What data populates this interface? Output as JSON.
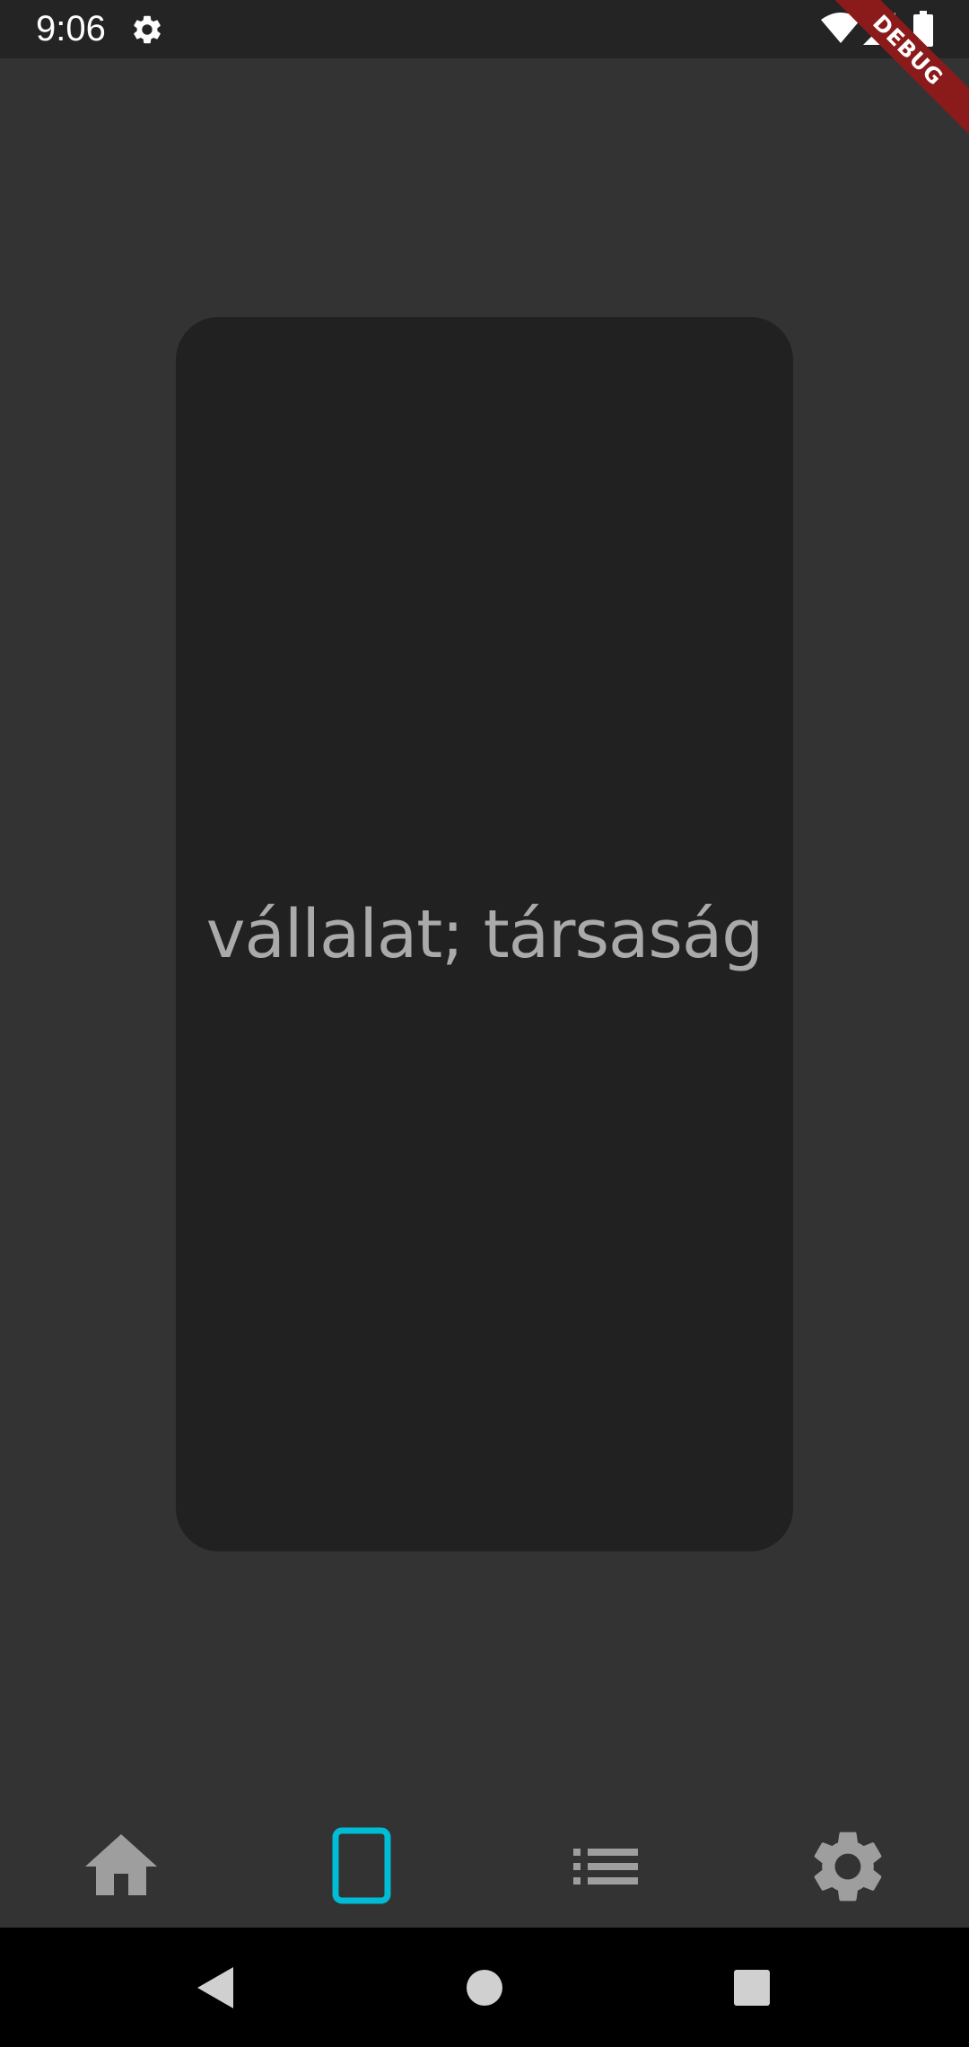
{
  "status_bar": {
    "time": "9:06",
    "icons": [
      "settings-icon",
      "wifi-icon",
      "signal-icon",
      "battery-icon"
    ]
  },
  "debug_banner": {
    "label": "DEBUG",
    "color": "#8b1a1a"
  },
  "flashcard": {
    "text": "vállalat; társaság"
  },
  "bottom_nav": {
    "items": [
      {
        "icon": "home-icon",
        "selected": false
      },
      {
        "icon": "card-icon",
        "selected": true
      },
      {
        "icon": "list-icon",
        "selected": false
      },
      {
        "icon": "settings-icon",
        "selected": false
      }
    ],
    "active_color": "#00bcd4",
    "inactive_color": "#9e9e9e"
  },
  "system_nav": {
    "buttons": [
      "back-icon",
      "home-circle-icon",
      "recents-icon"
    ]
  },
  "colors": {
    "background": "#333333",
    "card": "#212121",
    "card_text": "#aaaaaa",
    "status_bar": "#242424"
  }
}
